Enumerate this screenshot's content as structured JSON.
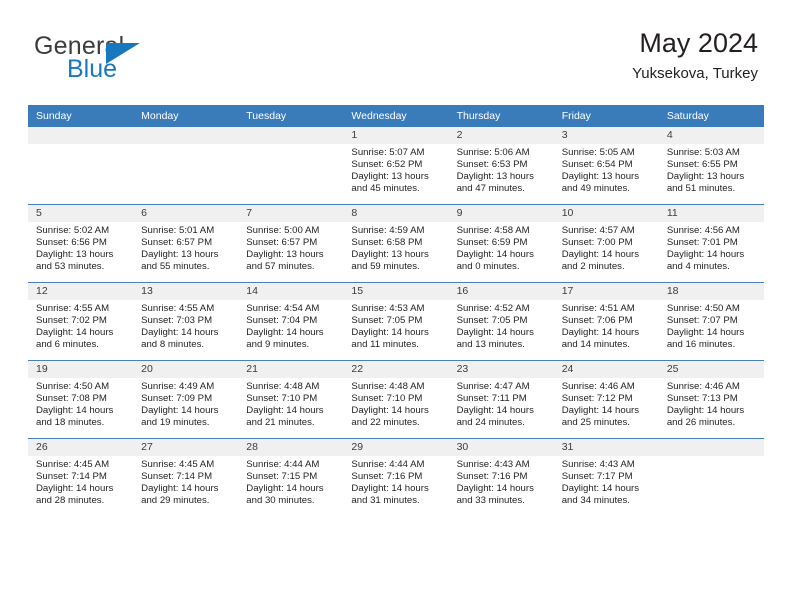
{
  "brand": {
    "word_one": "General",
    "word_two": "Blue",
    "triangle_icon": "brand-triangle-icon",
    "accent_color": "#1878be"
  },
  "header": {
    "title": "May 2024",
    "subtitle": "Yuksekova, Turkey"
  },
  "calendar": {
    "header_bg": "#3a7cba",
    "daynum_bg": "#f0f0f0",
    "grid_line": "#4a7fbc",
    "weekday_headers": [
      "Sunday",
      "Monday",
      "Tuesday",
      "Wednesday",
      "Thursday",
      "Friday",
      "Saturday"
    ],
    "weeks": [
      [
        {
          "day": "",
          "sunrise": "",
          "sunset": "",
          "daylight": "",
          "daylight2": "",
          "blank": true
        },
        {
          "day": "",
          "sunrise": "",
          "sunset": "",
          "daylight": "",
          "daylight2": "",
          "blank": true
        },
        {
          "day": "",
          "sunrise": "",
          "sunset": "",
          "daylight": "",
          "daylight2": "",
          "blank": true
        },
        {
          "day": "1",
          "sunrise": "Sunrise: 5:07 AM",
          "sunset": "Sunset: 6:52 PM",
          "daylight": "Daylight: 13 hours",
          "daylight2": "and 45 minutes."
        },
        {
          "day": "2",
          "sunrise": "Sunrise: 5:06 AM",
          "sunset": "Sunset: 6:53 PM",
          "daylight": "Daylight: 13 hours",
          "daylight2": "and 47 minutes."
        },
        {
          "day": "3",
          "sunrise": "Sunrise: 5:05 AM",
          "sunset": "Sunset: 6:54 PM",
          "daylight": "Daylight: 13 hours",
          "daylight2": "and 49 minutes."
        },
        {
          "day": "4",
          "sunrise": "Sunrise: 5:03 AM",
          "sunset": "Sunset: 6:55 PM",
          "daylight": "Daylight: 13 hours",
          "daylight2": "and 51 minutes."
        }
      ],
      [
        {
          "day": "5",
          "sunrise": "Sunrise: 5:02 AM",
          "sunset": "Sunset: 6:56 PM",
          "daylight": "Daylight: 13 hours",
          "daylight2": "and 53 minutes."
        },
        {
          "day": "6",
          "sunrise": "Sunrise: 5:01 AM",
          "sunset": "Sunset: 6:57 PM",
          "daylight": "Daylight: 13 hours",
          "daylight2": "and 55 minutes."
        },
        {
          "day": "7",
          "sunrise": "Sunrise: 5:00 AM",
          "sunset": "Sunset: 6:57 PM",
          "daylight": "Daylight: 13 hours",
          "daylight2": "and 57 minutes."
        },
        {
          "day": "8",
          "sunrise": "Sunrise: 4:59 AM",
          "sunset": "Sunset: 6:58 PM",
          "daylight": "Daylight: 13 hours",
          "daylight2": "and 59 minutes."
        },
        {
          "day": "9",
          "sunrise": "Sunrise: 4:58 AM",
          "sunset": "Sunset: 6:59 PM",
          "daylight": "Daylight: 14 hours",
          "daylight2": "and 0 minutes."
        },
        {
          "day": "10",
          "sunrise": "Sunrise: 4:57 AM",
          "sunset": "Sunset: 7:00 PM",
          "daylight": "Daylight: 14 hours",
          "daylight2": "and 2 minutes."
        },
        {
          "day": "11",
          "sunrise": "Sunrise: 4:56 AM",
          "sunset": "Sunset: 7:01 PM",
          "daylight": "Daylight: 14 hours",
          "daylight2": "and 4 minutes."
        }
      ],
      [
        {
          "day": "12",
          "sunrise": "Sunrise: 4:55 AM",
          "sunset": "Sunset: 7:02 PM",
          "daylight": "Daylight: 14 hours",
          "daylight2": "and 6 minutes."
        },
        {
          "day": "13",
          "sunrise": "Sunrise: 4:55 AM",
          "sunset": "Sunset: 7:03 PM",
          "daylight": "Daylight: 14 hours",
          "daylight2": "and 8 minutes."
        },
        {
          "day": "14",
          "sunrise": "Sunrise: 4:54 AM",
          "sunset": "Sunset: 7:04 PM",
          "daylight": "Daylight: 14 hours",
          "daylight2": "and 9 minutes."
        },
        {
          "day": "15",
          "sunrise": "Sunrise: 4:53 AM",
          "sunset": "Sunset: 7:05 PM",
          "daylight": "Daylight: 14 hours",
          "daylight2": "and 11 minutes."
        },
        {
          "day": "16",
          "sunrise": "Sunrise: 4:52 AM",
          "sunset": "Sunset: 7:05 PM",
          "daylight": "Daylight: 14 hours",
          "daylight2": "and 13 minutes."
        },
        {
          "day": "17",
          "sunrise": "Sunrise: 4:51 AM",
          "sunset": "Sunset: 7:06 PM",
          "daylight": "Daylight: 14 hours",
          "daylight2": "and 14 minutes."
        },
        {
          "day": "18",
          "sunrise": "Sunrise: 4:50 AM",
          "sunset": "Sunset: 7:07 PM",
          "daylight": "Daylight: 14 hours",
          "daylight2": "and 16 minutes."
        }
      ],
      [
        {
          "day": "19",
          "sunrise": "Sunrise: 4:50 AM",
          "sunset": "Sunset: 7:08 PM",
          "daylight": "Daylight: 14 hours",
          "daylight2": "and 18 minutes."
        },
        {
          "day": "20",
          "sunrise": "Sunrise: 4:49 AM",
          "sunset": "Sunset: 7:09 PM",
          "daylight": "Daylight: 14 hours",
          "daylight2": "and 19 minutes."
        },
        {
          "day": "21",
          "sunrise": "Sunrise: 4:48 AM",
          "sunset": "Sunset: 7:10 PM",
          "daylight": "Daylight: 14 hours",
          "daylight2": "and 21 minutes."
        },
        {
          "day": "22",
          "sunrise": "Sunrise: 4:48 AM",
          "sunset": "Sunset: 7:10 PM",
          "daylight": "Daylight: 14 hours",
          "daylight2": "and 22 minutes."
        },
        {
          "day": "23",
          "sunrise": "Sunrise: 4:47 AM",
          "sunset": "Sunset: 7:11 PM",
          "daylight": "Daylight: 14 hours",
          "daylight2": "and 24 minutes."
        },
        {
          "day": "24",
          "sunrise": "Sunrise: 4:46 AM",
          "sunset": "Sunset: 7:12 PM",
          "daylight": "Daylight: 14 hours",
          "daylight2": "and 25 minutes."
        },
        {
          "day": "25",
          "sunrise": "Sunrise: 4:46 AM",
          "sunset": "Sunset: 7:13 PM",
          "daylight": "Daylight: 14 hours",
          "daylight2": "and 26 minutes."
        }
      ],
      [
        {
          "day": "26",
          "sunrise": "Sunrise: 4:45 AM",
          "sunset": "Sunset: 7:14 PM",
          "daylight": "Daylight: 14 hours",
          "daylight2": "and 28 minutes."
        },
        {
          "day": "27",
          "sunrise": "Sunrise: 4:45 AM",
          "sunset": "Sunset: 7:14 PM",
          "daylight": "Daylight: 14 hours",
          "daylight2": "and 29 minutes."
        },
        {
          "day": "28",
          "sunrise": "Sunrise: 4:44 AM",
          "sunset": "Sunset: 7:15 PM",
          "daylight": "Daylight: 14 hours",
          "daylight2": "and 30 minutes."
        },
        {
          "day": "29",
          "sunrise": "Sunrise: 4:44 AM",
          "sunset": "Sunset: 7:16 PM",
          "daylight": "Daylight: 14 hours",
          "daylight2": "and 31 minutes."
        },
        {
          "day": "30",
          "sunrise": "Sunrise: 4:43 AM",
          "sunset": "Sunset: 7:16 PM",
          "daylight": "Daylight: 14 hours",
          "daylight2": "and 33 minutes."
        },
        {
          "day": "31",
          "sunrise": "Sunrise: 4:43 AM",
          "sunset": "Sunset: 7:17 PM",
          "daylight": "Daylight: 14 hours",
          "daylight2": "and 34 minutes."
        },
        {
          "day": "",
          "sunrise": "",
          "sunset": "",
          "daylight": "",
          "daylight2": "",
          "blank": true
        }
      ]
    ]
  }
}
